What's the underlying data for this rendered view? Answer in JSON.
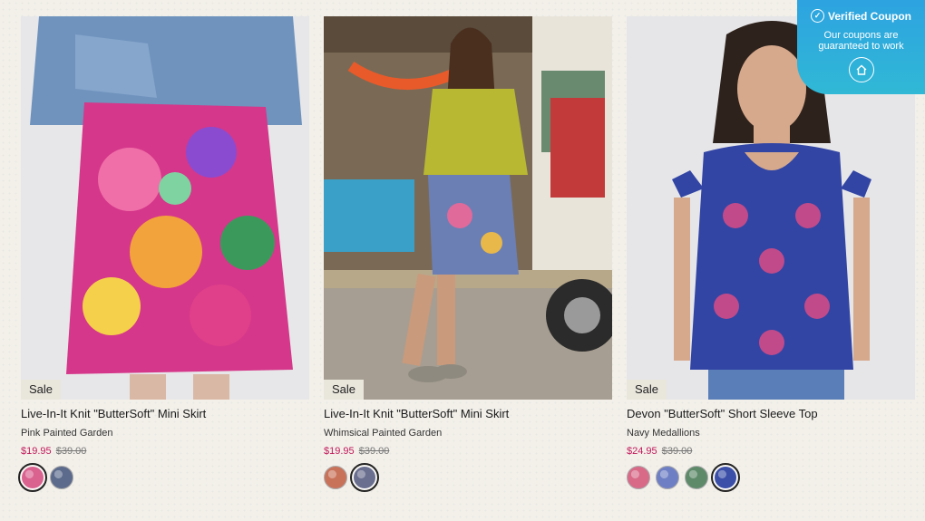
{
  "products": [
    {
      "sale_label": "Sale",
      "title": "Live-In-It Knit \"ButterSoft\" Mini Skirt",
      "variant": "Pink Painted Garden",
      "price": "$19.95",
      "original_price": "$39.00",
      "swatches": [
        "#d9628f",
        "#5c6b8c"
      ],
      "selected_swatch": 0
    },
    {
      "sale_label": "Sale",
      "title": "Live-In-It Knit \"ButterSoft\" Mini Skirt",
      "variant": "Whimsical Painted Garden",
      "price": "$19.95",
      "original_price": "$39.00",
      "swatches": [
        "#c9725a",
        "#6b6f8f"
      ],
      "selected_swatch": 1
    },
    {
      "sale_label": "Sale",
      "title": "Devon \"ButterSoft\" Short Sleeve Top",
      "variant": "Navy Medallions",
      "price": "$24.95",
      "original_price": "$39.00",
      "swatches": [
        "#d86a88",
        "#6f7fc4",
        "#5e8a6a",
        "#3b4fa8"
      ],
      "selected_swatch": 3
    }
  ],
  "coupon": {
    "title": "Verified Coupon",
    "line1": "Our coupons are",
    "line2": "guaranteed to work",
    "accent": "#2da3e0",
    "icon": "house-icon"
  },
  "colors": {
    "sale_price": "#c2185b",
    "background": "#f3f0ea"
  }
}
